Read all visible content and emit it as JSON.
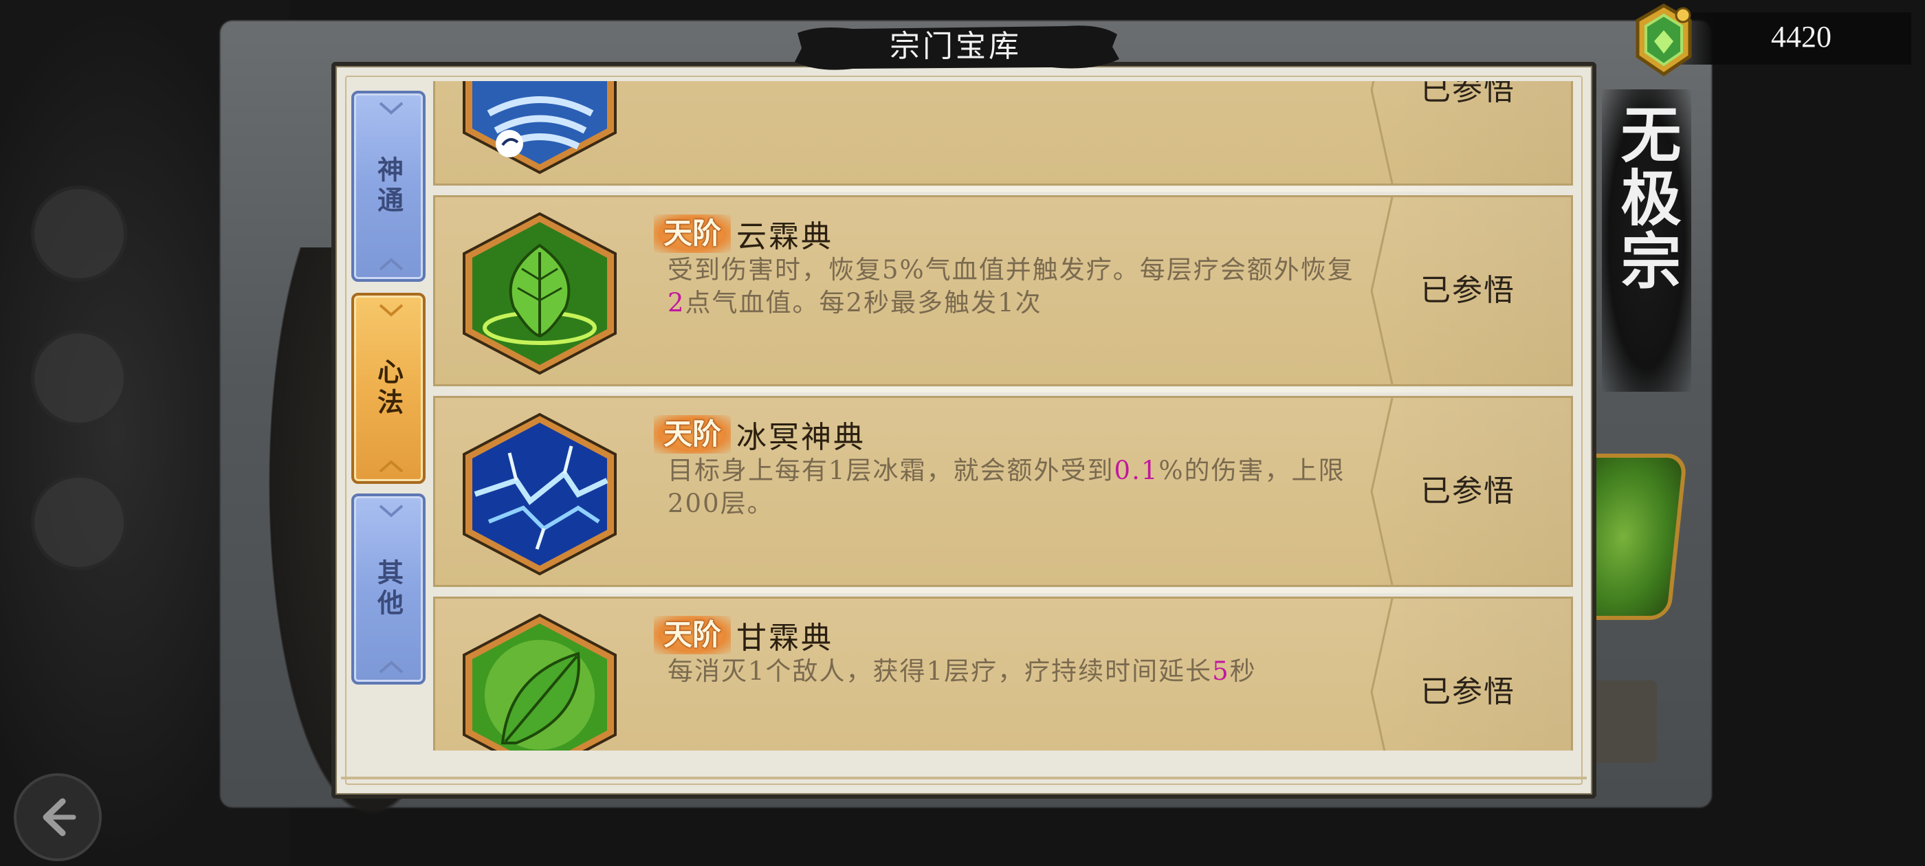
{
  "title": "宗门宝库",
  "currency": {
    "value": "4420",
    "icon": "jade-token-icon"
  },
  "sect": {
    "name": "无极宗"
  },
  "tabs": [
    {
      "label": "神通",
      "active": false
    },
    {
      "label": "心法",
      "active": true
    },
    {
      "label": "其他",
      "active": false
    }
  ],
  "items": [
    {
      "tier": "",
      "name": "",
      "desc_parts": [],
      "status": "已参悟",
      "icon": "blue-swirl-icon"
    },
    {
      "tier": "天阶",
      "name": "云霖典",
      "desc_parts": [
        {
          "text": "受到伤害时，恢复5%气血值并触发疗。每层疗会额外恢复",
          "hl": false
        },
        {
          "text": "2",
          "hl": true
        },
        {
          "text": "点气血值。每2秒最多触发1次",
          "hl": false
        }
      ],
      "status": "已参悟",
      "icon": "green-leaf-icon"
    },
    {
      "tier": "天阶",
      "name": "冰冥神典",
      "desc_parts": [
        {
          "text": "目标身上每有1层冰霜，就会额外受到",
          "hl": false
        },
        {
          "text": "0.1",
          "hl": true
        },
        {
          "text": "%的伤害，上限200层。",
          "hl": false
        }
      ],
      "status": "已参悟",
      "icon": "ice-lightning-icon"
    },
    {
      "tier": "天阶",
      "name": "甘霖典",
      "desc_parts": [
        {
          "text": "每消灭1个敌人，获得1层疗，疗持续时间延长",
          "hl": false
        },
        {
          "text": "5",
          "hl": true
        },
        {
          "text": "秒",
          "hl": false
        }
      ],
      "status": "已参悟",
      "icon": "leaf-glow-icon"
    }
  ],
  "colors": {
    "highlight": "#c0189e",
    "tier_badge": "#e98a37",
    "tab_active": "#efb04e",
    "tab_inactive": "#8aa5e2",
    "item_bg": "#d6bd86"
  }
}
